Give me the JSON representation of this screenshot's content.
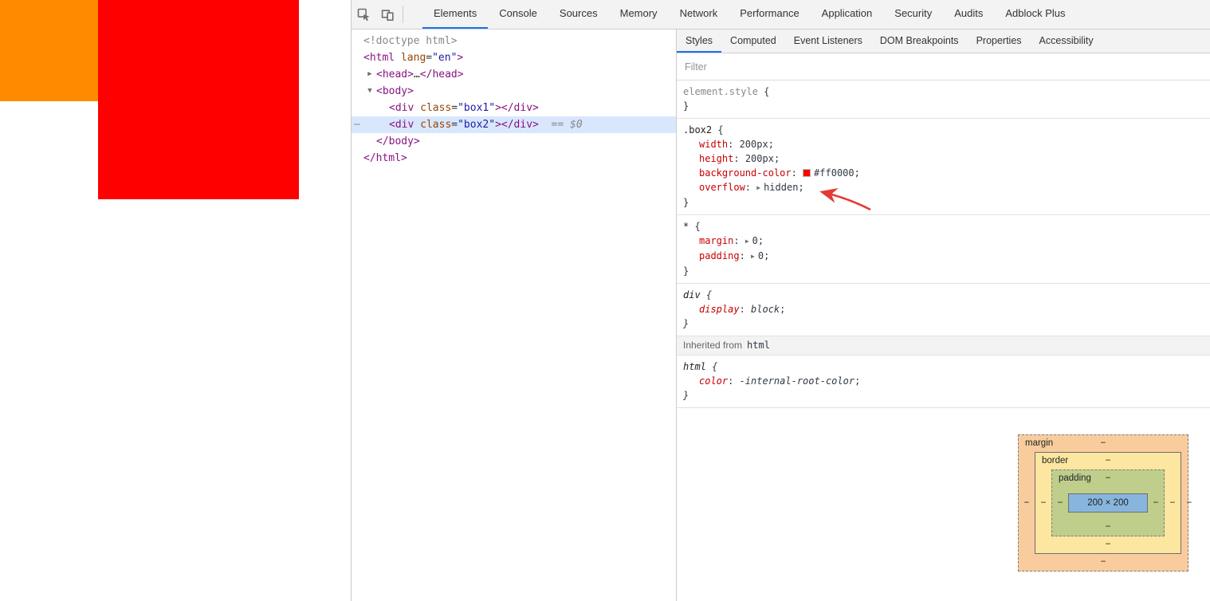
{
  "colors": {
    "accent": "#1a73e8",
    "selection": "#d9e7fd",
    "annotation": "#e53935"
  },
  "page": {
    "box1_color": "#ff8a00",
    "box2_color": "#ff0000"
  },
  "toolbar": {
    "inspect_icon": "inspect-element-icon",
    "device_icon": "toggle-device-toolbar-icon",
    "tabs": [
      {
        "label": "Elements",
        "selected": true
      },
      {
        "label": "Console"
      },
      {
        "label": "Sources"
      },
      {
        "label": "Memory"
      },
      {
        "label": "Network"
      },
      {
        "label": "Performance"
      },
      {
        "label": "Application"
      },
      {
        "label": "Security"
      },
      {
        "label": "Audits"
      },
      {
        "label": "Adblock Plus"
      }
    ]
  },
  "dom_tree": {
    "more_button": "⋯",
    "lines": [
      {
        "indent": 0,
        "tokens": [
          {
            "t": "doctype",
            "s": "<!doctype html>"
          }
        ]
      },
      {
        "indent": 0,
        "tokens": [
          {
            "t": "tag",
            "s": "<html"
          },
          {
            "t": "attr",
            "s": " lang"
          },
          {
            "t": "plain",
            "s": "="
          },
          {
            "t": "val",
            "s": "\"en\""
          },
          {
            "t": "tag",
            "s": ">"
          }
        ]
      },
      {
        "indent": 1,
        "expander": "collapsed",
        "tokens": [
          {
            "t": "tag",
            "s": "<head>"
          },
          {
            "t": "plain",
            "s": "…"
          },
          {
            "t": "tag",
            "s": "</head>"
          }
        ]
      },
      {
        "indent": 1,
        "expander": "expanded",
        "tokens": [
          {
            "t": "tag",
            "s": "<body>"
          }
        ]
      },
      {
        "indent": 2,
        "tokens": [
          {
            "t": "tag",
            "s": "<div"
          },
          {
            "t": "attr",
            "s": " class"
          },
          {
            "t": "plain",
            "s": "="
          },
          {
            "t": "val",
            "s": "\"box1\""
          },
          {
            "t": "tag",
            "s": "></div>"
          }
        ]
      },
      {
        "indent": 2,
        "selected": true,
        "more": true,
        "tokens": [
          {
            "t": "tag",
            "s": "<div"
          },
          {
            "t": "attr",
            "s": " class"
          },
          {
            "t": "plain",
            "s": "="
          },
          {
            "t": "val",
            "s": "\"box2\""
          },
          {
            "t": "tag",
            "s": "></div>"
          },
          {
            "t": "hint",
            "s": "  == $0"
          }
        ]
      },
      {
        "indent": 1,
        "tokens": [
          {
            "t": "tag",
            "s": "</body>"
          }
        ]
      },
      {
        "indent": 0,
        "tokens": [
          {
            "t": "tag",
            "s": "</html>"
          }
        ]
      }
    ]
  },
  "styles_pane": {
    "tabs": [
      {
        "label": "Styles",
        "selected": true
      },
      {
        "label": "Computed"
      },
      {
        "label": "Event Listeners"
      },
      {
        "label": "DOM Breakpoints"
      },
      {
        "label": "Properties"
      },
      {
        "label": "Accessibility"
      }
    ],
    "filter_placeholder": "Filter",
    "sections": [
      {
        "type": "rule",
        "selector": "element.style",
        "muted": true,
        "properties": []
      },
      {
        "type": "rule",
        "selector": ".box2",
        "properties": [
          {
            "name": "width",
            "value": "200px"
          },
          {
            "name": "height",
            "value": "200px"
          },
          {
            "name": "background-color",
            "value": "#ff0000",
            "swatch": "#ff0000"
          },
          {
            "name": "overflow",
            "value": "hidden",
            "expander": true
          }
        ]
      },
      {
        "type": "rule",
        "selector": "*",
        "properties": [
          {
            "name": "margin",
            "value": "0",
            "expander": true
          },
          {
            "name": "padding",
            "value": "0",
            "expander": true
          }
        ]
      },
      {
        "type": "rule",
        "selector": "div",
        "italic": true,
        "properties": [
          {
            "name": "display",
            "value": "block"
          }
        ]
      },
      {
        "type": "inherited",
        "prefix": "Inherited from",
        "node": "html"
      },
      {
        "type": "rule",
        "selector": "html",
        "italic": true,
        "properties": [
          {
            "name": "color",
            "value": "-internal-root-color"
          }
        ]
      }
    ],
    "box_model": {
      "margin_label": "margin",
      "border_label": "border",
      "padding_label": "padding",
      "content_size": "200 × 200",
      "dash": "−",
      "margin_color": "#f9cc9d",
      "border_color": "#fce6a0",
      "padding_color": "#c0ce8c",
      "content_color": "#88b5dd"
    }
  }
}
